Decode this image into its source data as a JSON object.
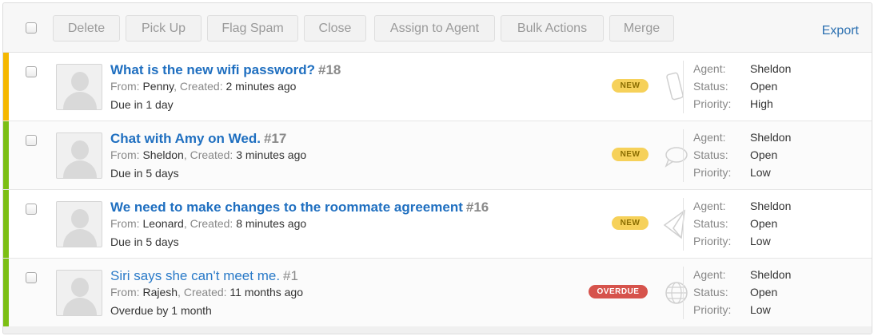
{
  "toolbar": {
    "buttons": [
      "Delete",
      "Pick Up",
      "Flag Spam",
      "Close",
      "Assign to Agent",
      "Bulk Actions",
      "Merge"
    ],
    "export_label": "Export"
  },
  "labels": {
    "from": "From:",
    "created": "Created:",
    "agent": "Agent:",
    "status": "Status:",
    "priority": "Priority:"
  },
  "tickets": [
    {
      "title": "What is the new wifi password?",
      "number": "#18",
      "from": "Penny",
      "created": "2 minutes ago",
      "due": "Due in 1 day",
      "badge": "NEW",
      "channel_icon": "phone-icon",
      "agent": "Sheldon",
      "status": "Open",
      "priority": "High",
      "stripe_color": "#f5b800",
      "unread": true
    },
    {
      "title": "Chat with Amy on Wed.",
      "number": "#17",
      "from": "Sheldon",
      "created": "3 minutes ago",
      "due": "Due in 5 days",
      "badge": "NEW",
      "channel_icon": "chat-bubble-icon",
      "agent": "Sheldon",
      "status": "Open",
      "priority": "Low",
      "stripe_color": "#7cbf14",
      "unread": true
    },
    {
      "title": "We need to make changes to the roommate agreement",
      "number": "#16",
      "from": "Leonard",
      "created": "8 minutes ago",
      "due": "Due in 5 days",
      "badge": "NEW",
      "channel_icon": "paper-plane-icon",
      "agent": "Sheldon",
      "status": "Open",
      "priority": "Low",
      "stripe_color": "#7cbf14",
      "unread": true
    },
    {
      "title": "Siri says she can't meet me.",
      "number": "#1",
      "from": "Rajesh",
      "created": "11 months ago",
      "due": "Overdue by 1 month",
      "badge": "OVERDUE",
      "channel_icon": "globe-icon",
      "agent": "Sheldon",
      "status": "Open",
      "priority": "Low",
      "stripe_color": "#7cbf14",
      "unread": false
    }
  ]
}
